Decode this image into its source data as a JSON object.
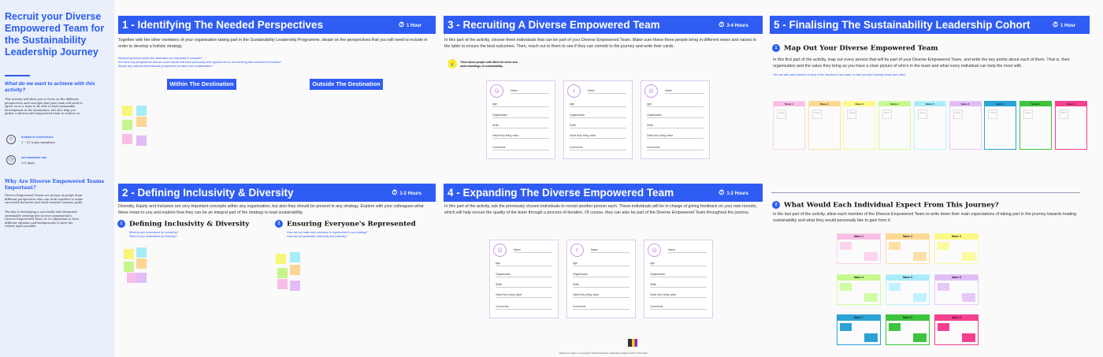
{
  "sidebar": {
    "title": "Recruit your Diverse Empowered Team for the Sustainability Leadership Journey",
    "question": "What do we want to achieve with this activity?",
    "intro": "This activity will allow you to focus on the different perspectives and concepts that your team will need to agree on as a team to be able to lead sustainable development in the destination, but also help you gather a diverse and empowered team to achieve so.",
    "participants_label": "NUMBER OF PARTICIPANTS",
    "participants_value": "1 - 10 team members",
    "time_label": "RECOMMENDED TIME",
    "time_value": "3-5 days",
    "why_heading": "Why Are Diverse Empowered Teams Important?",
    "why_p1": "Diverse Empowered Teams are groups of people from different perspectives who can work together to make successful decisions and work towards common goals.",
    "why_p2": "The key to developing a successful and integrated sustainable strategy lies in your organisation's Diverse Empowered Team, as it's important to have different opinions and backgrounds to have the richest input possible."
  },
  "s1": {
    "title": "1 - Identifying The Needed Perspectives",
    "time": "1 Hour",
    "desc": "Together with the other members of your organisation taking part in the Sustainability Leadership Programme, ideate on the perspectives that you will need to include in order to develop a holistic strategy.",
    "questions": [
      "What perspectives within the destination are important to consider?",
      "Are there any perspectives that we could include that have previously been ignored due to not seeming that connected to tourism?",
      "Should any national /international perspectives be taken into consideration?"
    ],
    "btn_within": "Within The Destination",
    "btn_outside": "Outside The Destination"
  },
  "s2": {
    "title": "2 - Defining Inclusivity & Diversity",
    "time": "1-2 Hours",
    "desc": "Diversity, Equity and Inclusion are very important concepts within any organisation, but also they should be present in any strategy. Explore with your colleagues what these mean to you and explore how they can be an integral part of the strategy to lead sustainability.",
    "sub1": {
      "num": "1",
      "title": "Defining Inclusivity & Diversity",
      "q": [
        "What do you understand by Inclusivity?",
        "What do you understand by Diversity?"
      ]
    },
    "sub2": {
      "num": "2",
      "title": "Ensuring Everyone's Represented",
      "q": [
        "How can we make sure everyone is represented in our strategy?",
        "How can we guarantee Inclusivity and Diversity?"
      ]
    }
  },
  "s3": {
    "title": "3 - Recruiting A Diverse Empowered Team",
    "time": "3-4 Hours",
    "desc": "In this part of the activity, choose three individuals that can be part of your Diverse Empowered Team. Make sure these three people bring in different views and values to the table to ensure the best outcomes. Then, reach out to them to see if they can commit to the journey and write their cards.",
    "tip": "Think about people with different views and understandings of sustainability."
  },
  "card_fields": [
    "Name",
    "Age",
    "Organisation",
    "Skills",
    "Value they bring value",
    "Comments"
  ],
  "s4": {
    "title": "4 - Expanding The Diverse Empowered Team",
    "time": "1-2 Hours",
    "desc": "In this part of the activity, ask the previously chosen individuals to recruit another person each. These individuals will be in charge of giving feedback on your own recruits, which will help ensure the quality of the team through a process of iteration. Of course, they can also be part of the Diverse Empowered Team throughout the journey."
  },
  "s5": {
    "title": "5 - Finalising The Sustainability Leadership Cohort",
    "time": "1 Hour",
    "sub1": {
      "num": "1",
      "title": "Map Out Your Diverse Empowered Team",
      "desc": "In this first part of the activity, map out every person that will be part of your Diverse Empowered Team, and write the key points about each of them. That is, their organisation and the value they bring so you have a clear picture of who's in the team and what every individual can help the most with.",
      "note": "You can also add a picture of each of the members if you want, in case you don't already know each other."
    },
    "photo_label": "Photo",
    "sub2": {
      "num": "2",
      "title": "What Would Each Individual Expect From This Journey?",
      "desc": "In the last part of the activity, allow each member of the Diverse Empowered Team to write down their main expectations of taking part in the journey towards leading sustainability and what they would personally like to gain from it."
    },
    "members": [
      {
        "name": "Name 1",
        "color": "#f9bde6",
        "light": "#fcd3ef"
      },
      {
        "name": "Name 2",
        "color": "#fcd992",
        "light": "#fde0a6"
      },
      {
        "name": "Name 3",
        "color": "#fbf983",
        "light": "#fcfa9c"
      },
      {
        "name": "Name 4",
        "color": "#c7f98f",
        "light": "#d2fba6"
      },
      {
        "name": "Name 5",
        "color": "#a9ecfa",
        "light": "#bff2fc"
      },
      {
        "name": "Name 6",
        "color": "#e1bdf7",
        "light": "#e6c8f9"
      },
      {
        "name": "Name 7",
        "color": "#2ca2d6",
        "light": "#2ca2d6"
      },
      {
        "name": "Name 8",
        "color": "#3ec43e",
        "light": "#3ec43e"
      },
      {
        "name": "Name 9",
        "color": "#f4408f",
        "light": "#f4408f"
      }
    ]
  },
  "footer": {
    "copyright": "Material is subject to copyright © 2023 Destination Leadership | Digital Tourism Think Tank"
  },
  "colors": {
    "accent": "#2f5cf3",
    "sidebar_bg": "#e9effb"
  }
}
